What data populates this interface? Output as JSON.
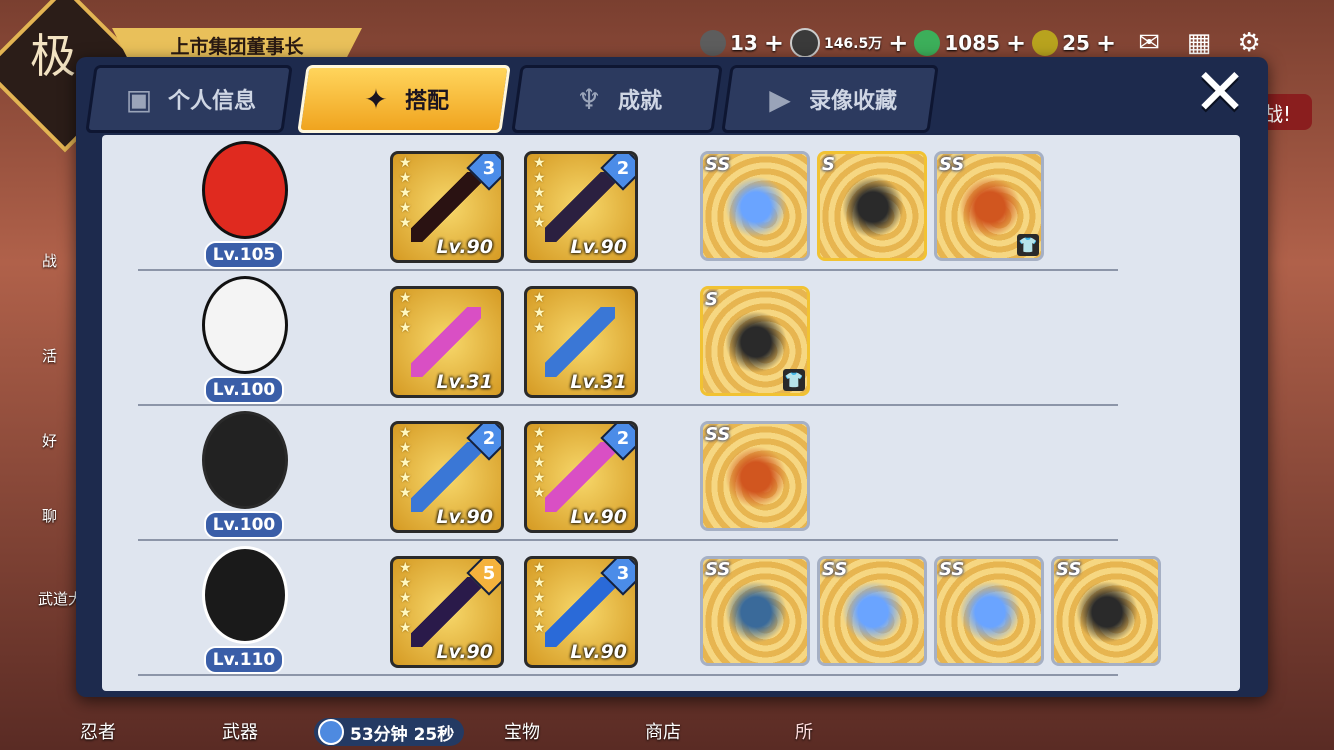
{
  "background": {
    "title_ribbon": "上市集团董事长",
    "badge_char": "极",
    "side_items": [
      "战",
      "活",
      "好",
      "聊",
      "武道大"
    ],
    "right_button": "战!"
  },
  "topbar": {
    "resources": [
      {
        "name": "ninja-coin",
        "value": "13",
        "color": "#5d5d5d"
      },
      {
        "name": "silver-coin",
        "value": "146.5万",
        "color": "#3a3a3a"
      },
      {
        "name": "green-gem",
        "value": "1085",
        "color": "#3caf5a"
      },
      {
        "name": "gold-gem",
        "value": "25",
        "color": "#b8a31e"
      }
    ],
    "plus": "+"
  },
  "tabs": [
    {
      "label": "个人信息",
      "icon": "profile-icon"
    },
    {
      "label": "搭配",
      "icon": "shuriken-icon",
      "active": true
    },
    {
      "label": "成就",
      "icon": "trophy-icon"
    },
    {
      "label": "录像收藏",
      "icon": "play-icon"
    }
  ],
  "close_label": "✕",
  "rows": [
    {
      "level": "Lv.105",
      "weapons": [
        {
          "lv": "Lv.90",
          "badge": "3",
          "badge_type": "blue",
          "stars": 5
        },
        {
          "lv": "Lv.90",
          "badge": "2",
          "badge_type": "blue",
          "stars": 5
        }
      ],
      "treasures": [
        {
          "grade": "SS",
          "shirt": false
        },
        {
          "grade": "S",
          "shirt": false
        },
        {
          "grade": "SS",
          "shirt": true
        }
      ]
    },
    {
      "level": "Lv.100",
      "weapons": [
        {
          "lv": "Lv.31",
          "badge": "",
          "badge_type": "",
          "stars": 3
        },
        {
          "lv": "Lv.31",
          "badge": "",
          "badge_type": "",
          "stars": 3
        }
      ],
      "treasures": [
        {
          "grade": "S",
          "shirt": true
        }
      ]
    },
    {
      "level": "Lv.100",
      "weapons": [
        {
          "lv": "Lv.90",
          "badge": "2",
          "badge_type": "blue",
          "stars": 5
        },
        {
          "lv": "Lv.90",
          "badge": "2",
          "badge_type": "blue",
          "stars": 5
        }
      ],
      "treasures": [
        {
          "grade": "SS",
          "shirt": false
        }
      ]
    },
    {
      "level": "Lv.110",
      "weapons": [
        {
          "lv": "Lv.90",
          "badge": "5",
          "badge_type": "gold",
          "stars": 5
        },
        {
          "lv": "Lv.90",
          "badge": "3",
          "badge_type": "blue",
          "stars": 5
        }
      ],
      "treasures": [
        {
          "grade": "SS",
          "shirt": false
        },
        {
          "grade": "SS",
          "shirt": false
        },
        {
          "grade": "SS",
          "shirt": false
        },
        {
          "grade": "SS",
          "shirt": false
        }
      ]
    }
  ],
  "bottom_nav": [
    "忍者",
    "武器",
    "宝物",
    "商店",
    "所"
  ],
  "timer": "53分钟 25秒"
}
